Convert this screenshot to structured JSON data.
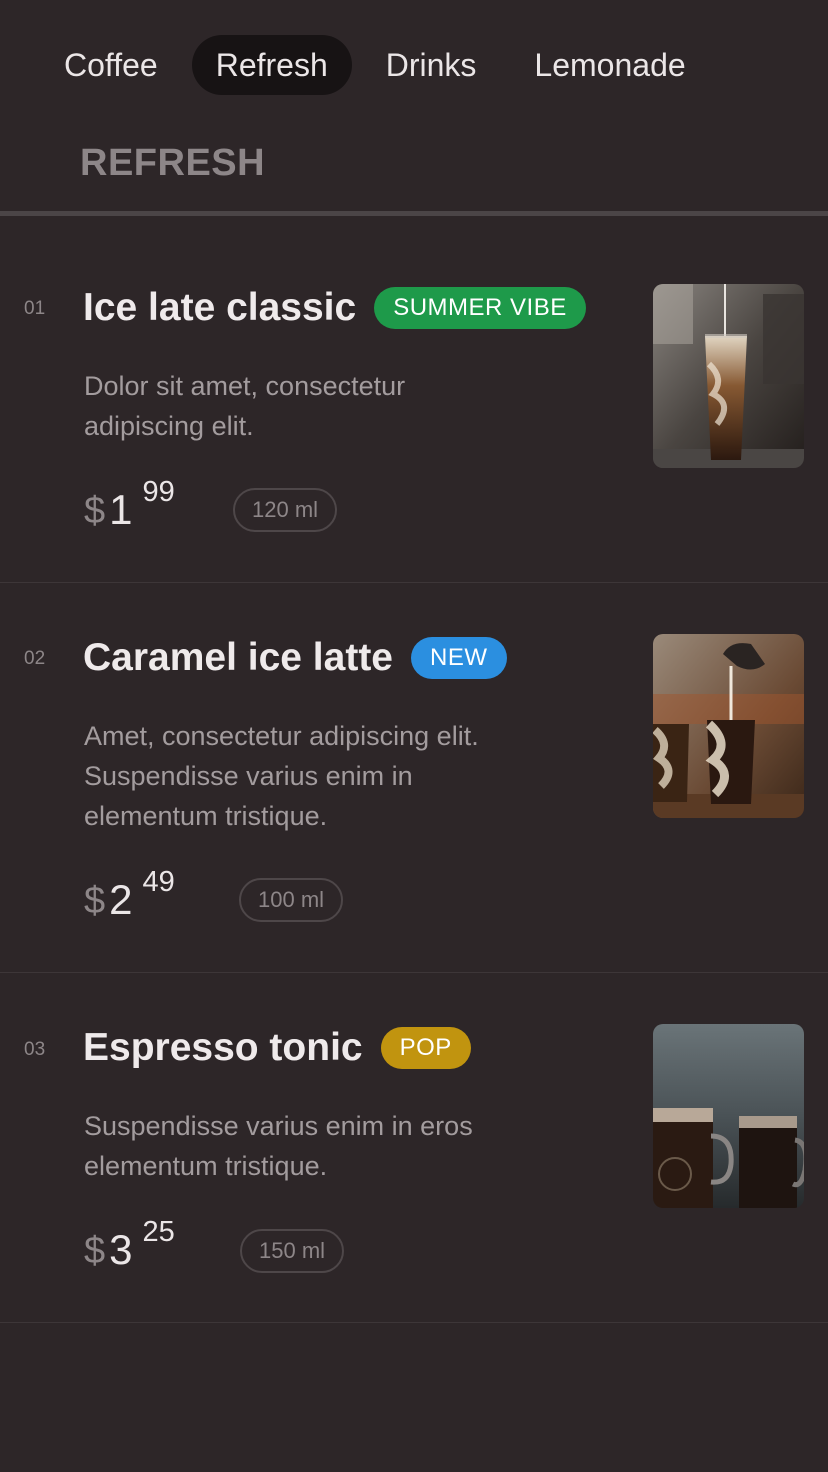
{
  "tabs": [
    {
      "label": "Coffee",
      "active": false
    },
    {
      "label": "Refresh",
      "active": true
    },
    {
      "label": "Drinks",
      "active": false
    },
    {
      "label": "Lemonade",
      "active": false
    }
  ],
  "section_title": "REFRESH",
  "items": [
    {
      "number": "01",
      "title": "Ice late classic",
      "badge": {
        "label": "SUMMER VIBE",
        "color": "#1e9a4a"
      },
      "description": "Dolor sit amet, consectetur adipiscing elit.",
      "currency": "$",
      "price_whole": "1",
      "price_cents": "99",
      "volume": "120 ml",
      "image": "iced-latte-pour-photo"
    },
    {
      "number": "02",
      "title": "Caramel ice latte",
      "badge": {
        "label": "NEW",
        "color": "#2b8fe0"
      },
      "description": "Amet, consectetur adipiscing elit. Suspendisse varius enim in elementum tristique.",
      "currency": "$",
      "price_whole": "2",
      "price_cents": "49",
      "volume": "100 ml",
      "image": "caramel-latte-pour-photo"
    },
    {
      "number": "03",
      "title": "Espresso tonic",
      "badge": {
        "label": "POP",
        "color": "#c1940f"
      },
      "description": "Suspendisse varius enim in eros elementum tristique.",
      "currency": "$",
      "price_whole": "3",
      "price_cents": "25",
      "volume": "150 ml",
      "image": "espresso-tonic-jars-photo"
    }
  ]
}
